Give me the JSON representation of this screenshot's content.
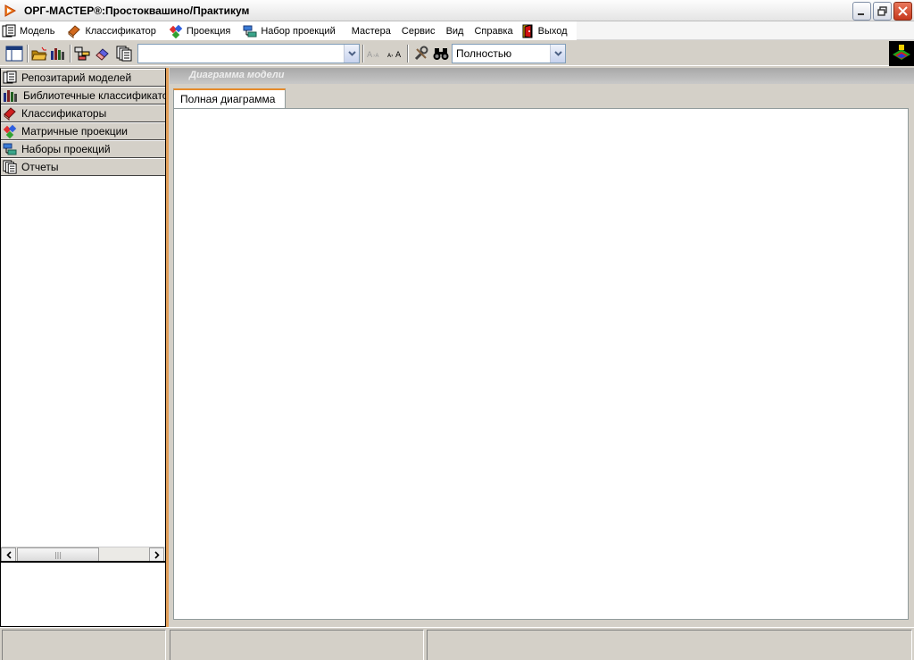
{
  "window": {
    "title": "ОРГ-МАСТЕР®:Простоквашино/Практикум",
    "controls": [
      "minimize-icon",
      "restore-icon",
      "close-icon"
    ]
  },
  "menu": {
    "items": [
      {
        "label": "Модель",
        "icon": "repository-icon"
      },
      {
        "label": "Классификатор",
        "icon": "book-icon"
      },
      {
        "label": "Проекция",
        "icon": "projection-icon"
      },
      {
        "label": "Набор проекций",
        "icon": "projection-set-icon"
      },
      {
        "label": "Мастера",
        "icon": ""
      },
      {
        "label": "Сервис",
        "icon": ""
      },
      {
        "label": "Вид",
        "icon": ""
      },
      {
        "label": "Справка",
        "icon": ""
      },
      {
        "label": "Выход",
        "icon": "exit-door-icon"
      }
    ]
  },
  "toolbar": {
    "model_combo_value": "",
    "zoom_combo_value": "Полностью"
  },
  "left_panel": {
    "items": [
      {
        "label": "Репозитарий моделей",
        "icon": "repository-icon"
      },
      {
        "label": "Библиотечные классификаторы",
        "icon": "library-books-icon"
      },
      {
        "label": "Классификаторы",
        "icon": "book-icon"
      },
      {
        "label": "Матричные проекции",
        "icon": "projection-icon"
      },
      {
        "label": "Наборы проекций",
        "icon": "projection-set-icon"
      },
      {
        "label": "Отчеты",
        "icon": "reports-icon"
      }
    ]
  },
  "diagram": {
    "header": "Диаграмма модели",
    "tabs": [
      {
        "label": "Полная диаграмма",
        "active": true
      }
    ]
  },
  "colors": {
    "accent": "#e68b2c",
    "window_bg": "#d4d0c8",
    "close_button": "#c6381d"
  }
}
